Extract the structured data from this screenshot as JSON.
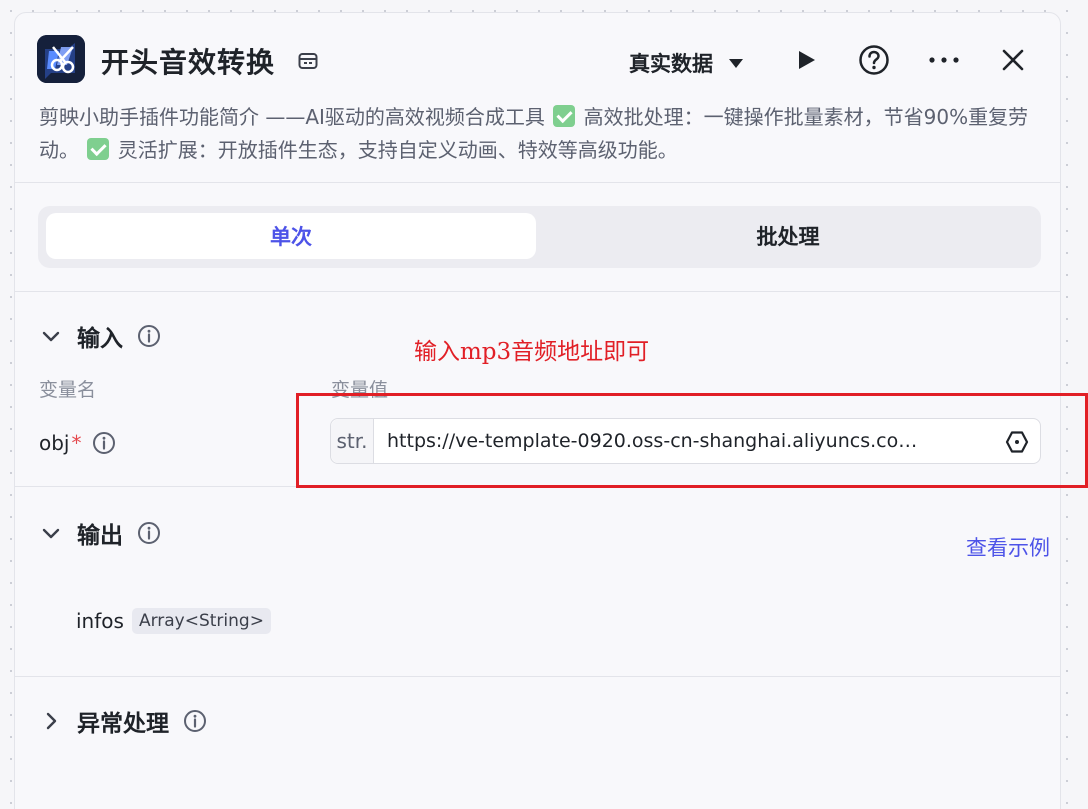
{
  "header": {
    "title": "开头音效转换",
    "logo_icon": "scissors-icon",
    "data_mode": "真实数据",
    "icons": [
      "store-icon",
      "play-icon",
      "help-icon",
      "more-icon",
      "close-icon"
    ]
  },
  "description": {
    "intro": "剪映小助手插件功能简介 ——AI驱动的高效视频合成工具 ",
    "point1": " 高效批处理：一键操作批量素材，节省90%重复劳动。 ",
    "point2": " 灵活扩展：开放插件生态，支持自定义动画、特效等高级功能。"
  },
  "tabs": [
    {
      "label": "单次",
      "active": true
    },
    {
      "label": "批处理",
      "active": false
    }
  ],
  "input_section": {
    "title": "输入",
    "col_name": "变量名",
    "col_value": "变量值",
    "param_name": "obj",
    "required_mark": "*",
    "type": "str.",
    "value": "https://ve-template-0920.oss-cn-shanghai.aliyuncs.co…"
  },
  "annotation": {
    "text": "输入mp3音频地址即可",
    "color": "#e11f26"
  },
  "output_section": {
    "title": "输出",
    "example_link": "查看示例",
    "field_name": "infos",
    "field_type": "Array<String>"
  },
  "exception_section": {
    "title": "异常处理"
  },
  "colors": {
    "accent": "#4d53e8",
    "annotation": "#e11f26",
    "check": "#7fcf8f"
  }
}
